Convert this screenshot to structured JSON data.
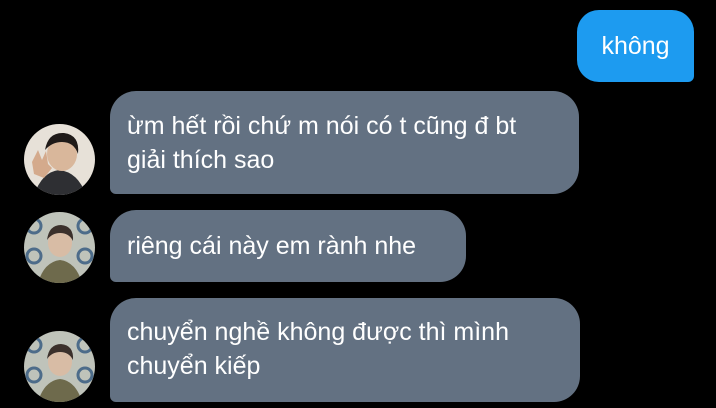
{
  "messages": [
    {
      "sender": "me",
      "text": "không"
    },
    {
      "sender": "other",
      "text": "ừm hết rồi chứ m nói có t cũng đ bt giải thích sao",
      "avatar": "avatar-hand-pose"
    },
    {
      "sender": "other",
      "text": "riêng cái này em rành nhe",
      "avatar": "avatar-patterned-wall"
    },
    {
      "sender": "other",
      "text": "chuyển nghề không được thì mình chuyển kiếp",
      "avatar": "avatar-patterned-wall"
    }
  ],
  "colors": {
    "background": "#000000",
    "outgoing_bubble": "#1d9bf0",
    "incoming_bubble": "#637182",
    "text": "#ffffff"
  }
}
